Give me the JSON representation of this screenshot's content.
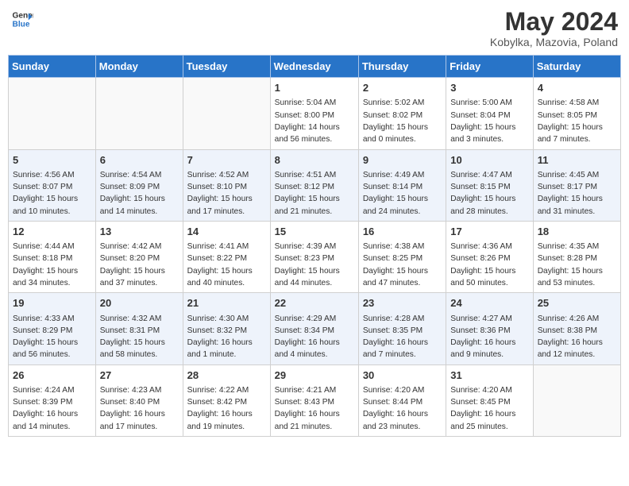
{
  "header": {
    "logo_line1": "General",
    "logo_line2": "Blue",
    "title": "May 2024",
    "location": "Kobylka, Mazovia, Poland"
  },
  "weekdays": [
    "Sunday",
    "Monday",
    "Tuesday",
    "Wednesday",
    "Thursday",
    "Friday",
    "Saturday"
  ],
  "weeks": [
    [
      {
        "day": "",
        "sunrise": "",
        "sunset": "",
        "daylight": ""
      },
      {
        "day": "",
        "sunrise": "",
        "sunset": "",
        "daylight": ""
      },
      {
        "day": "",
        "sunrise": "",
        "sunset": "",
        "daylight": ""
      },
      {
        "day": "1",
        "sunrise": "Sunrise: 5:04 AM",
        "sunset": "Sunset: 8:00 PM",
        "daylight": "Daylight: 14 hours and 56 minutes."
      },
      {
        "day": "2",
        "sunrise": "Sunrise: 5:02 AM",
        "sunset": "Sunset: 8:02 PM",
        "daylight": "Daylight: 15 hours and 0 minutes."
      },
      {
        "day": "3",
        "sunrise": "Sunrise: 5:00 AM",
        "sunset": "Sunset: 8:04 PM",
        "daylight": "Daylight: 15 hours and 3 minutes."
      },
      {
        "day": "4",
        "sunrise": "Sunrise: 4:58 AM",
        "sunset": "Sunset: 8:05 PM",
        "daylight": "Daylight: 15 hours and 7 minutes."
      }
    ],
    [
      {
        "day": "5",
        "sunrise": "Sunrise: 4:56 AM",
        "sunset": "Sunset: 8:07 PM",
        "daylight": "Daylight: 15 hours and 10 minutes."
      },
      {
        "day": "6",
        "sunrise": "Sunrise: 4:54 AM",
        "sunset": "Sunset: 8:09 PM",
        "daylight": "Daylight: 15 hours and 14 minutes."
      },
      {
        "day": "7",
        "sunrise": "Sunrise: 4:52 AM",
        "sunset": "Sunset: 8:10 PM",
        "daylight": "Daylight: 15 hours and 17 minutes."
      },
      {
        "day": "8",
        "sunrise": "Sunrise: 4:51 AM",
        "sunset": "Sunset: 8:12 PM",
        "daylight": "Daylight: 15 hours and 21 minutes."
      },
      {
        "day": "9",
        "sunrise": "Sunrise: 4:49 AM",
        "sunset": "Sunset: 8:14 PM",
        "daylight": "Daylight: 15 hours and 24 minutes."
      },
      {
        "day": "10",
        "sunrise": "Sunrise: 4:47 AM",
        "sunset": "Sunset: 8:15 PM",
        "daylight": "Daylight: 15 hours and 28 minutes."
      },
      {
        "day": "11",
        "sunrise": "Sunrise: 4:45 AM",
        "sunset": "Sunset: 8:17 PM",
        "daylight": "Daylight: 15 hours and 31 minutes."
      }
    ],
    [
      {
        "day": "12",
        "sunrise": "Sunrise: 4:44 AM",
        "sunset": "Sunset: 8:18 PM",
        "daylight": "Daylight: 15 hours and 34 minutes."
      },
      {
        "day": "13",
        "sunrise": "Sunrise: 4:42 AM",
        "sunset": "Sunset: 8:20 PM",
        "daylight": "Daylight: 15 hours and 37 minutes."
      },
      {
        "day": "14",
        "sunrise": "Sunrise: 4:41 AM",
        "sunset": "Sunset: 8:22 PM",
        "daylight": "Daylight: 15 hours and 40 minutes."
      },
      {
        "day": "15",
        "sunrise": "Sunrise: 4:39 AM",
        "sunset": "Sunset: 8:23 PM",
        "daylight": "Daylight: 15 hours and 44 minutes."
      },
      {
        "day": "16",
        "sunrise": "Sunrise: 4:38 AM",
        "sunset": "Sunset: 8:25 PM",
        "daylight": "Daylight: 15 hours and 47 minutes."
      },
      {
        "day": "17",
        "sunrise": "Sunrise: 4:36 AM",
        "sunset": "Sunset: 8:26 PM",
        "daylight": "Daylight: 15 hours and 50 minutes."
      },
      {
        "day": "18",
        "sunrise": "Sunrise: 4:35 AM",
        "sunset": "Sunset: 8:28 PM",
        "daylight": "Daylight: 15 hours and 53 minutes."
      }
    ],
    [
      {
        "day": "19",
        "sunrise": "Sunrise: 4:33 AM",
        "sunset": "Sunset: 8:29 PM",
        "daylight": "Daylight: 15 hours and 56 minutes."
      },
      {
        "day": "20",
        "sunrise": "Sunrise: 4:32 AM",
        "sunset": "Sunset: 8:31 PM",
        "daylight": "Daylight: 15 hours and 58 minutes."
      },
      {
        "day": "21",
        "sunrise": "Sunrise: 4:30 AM",
        "sunset": "Sunset: 8:32 PM",
        "daylight": "Daylight: 16 hours and 1 minute."
      },
      {
        "day": "22",
        "sunrise": "Sunrise: 4:29 AM",
        "sunset": "Sunset: 8:34 PM",
        "daylight": "Daylight: 16 hours and 4 minutes."
      },
      {
        "day": "23",
        "sunrise": "Sunrise: 4:28 AM",
        "sunset": "Sunset: 8:35 PM",
        "daylight": "Daylight: 16 hours and 7 minutes."
      },
      {
        "day": "24",
        "sunrise": "Sunrise: 4:27 AM",
        "sunset": "Sunset: 8:36 PM",
        "daylight": "Daylight: 16 hours and 9 minutes."
      },
      {
        "day": "25",
        "sunrise": "Sunrise: 4:26 AM",
        "sunset": "Sunset: 8:38 PM",
        "daylight": "Daylight: 16 hours and 12 minutes."
      }
    ],
    [
      {
        "day": "26",
        "sunrise": "Sunrise: 4:24 AM",
        "sunset": "Sunset: 8:39 PM",
        "daylight": "Daylight: 16 hours and 14 minutes."
      },
      {
        "day": "27",
        "sunrise": "Sunrise: 4:23 AM",
        "sunset": "Sunset: 8:40 PM",
        "daylight": "Daylight: 16 hours and 17 minutes."
      },
      {
        "day": "28",
        "sunrise": "Sunrise: 4:22 AM",
        "sunset": "Sunset: 8:42 PM",
        "daylight": "Daylight: 16 hours and 19 minutes."
      },
      {
        "day": "29",
        "sunrise": "Sunrise: 4:21 AM",
        "sunset": "Sunset: 8:43 PM",
        "daylight": "Daylight: 16 hours and 21 minutes."
      },
      {
        "day": "30",
        "sunrise": "Sunrise: 4:20 AM",
        "sunset": "Sunset: 8:44 PM",
        "daylight": "Daylight: 16 hours and 23 minutes."
      },
      {
        "day": "31",
        "sunrise": "Sunrise: 4:20 AM",
        "sunset": "Sunset: 8:45 PM",
        "daylight": "Daylight: 16 hours and 25 minutes."
      },
      {
        "day": "",
        "sunrise": "",
        "sunset": "",
        "daylight": ""
      }
    ]
  ]
}
